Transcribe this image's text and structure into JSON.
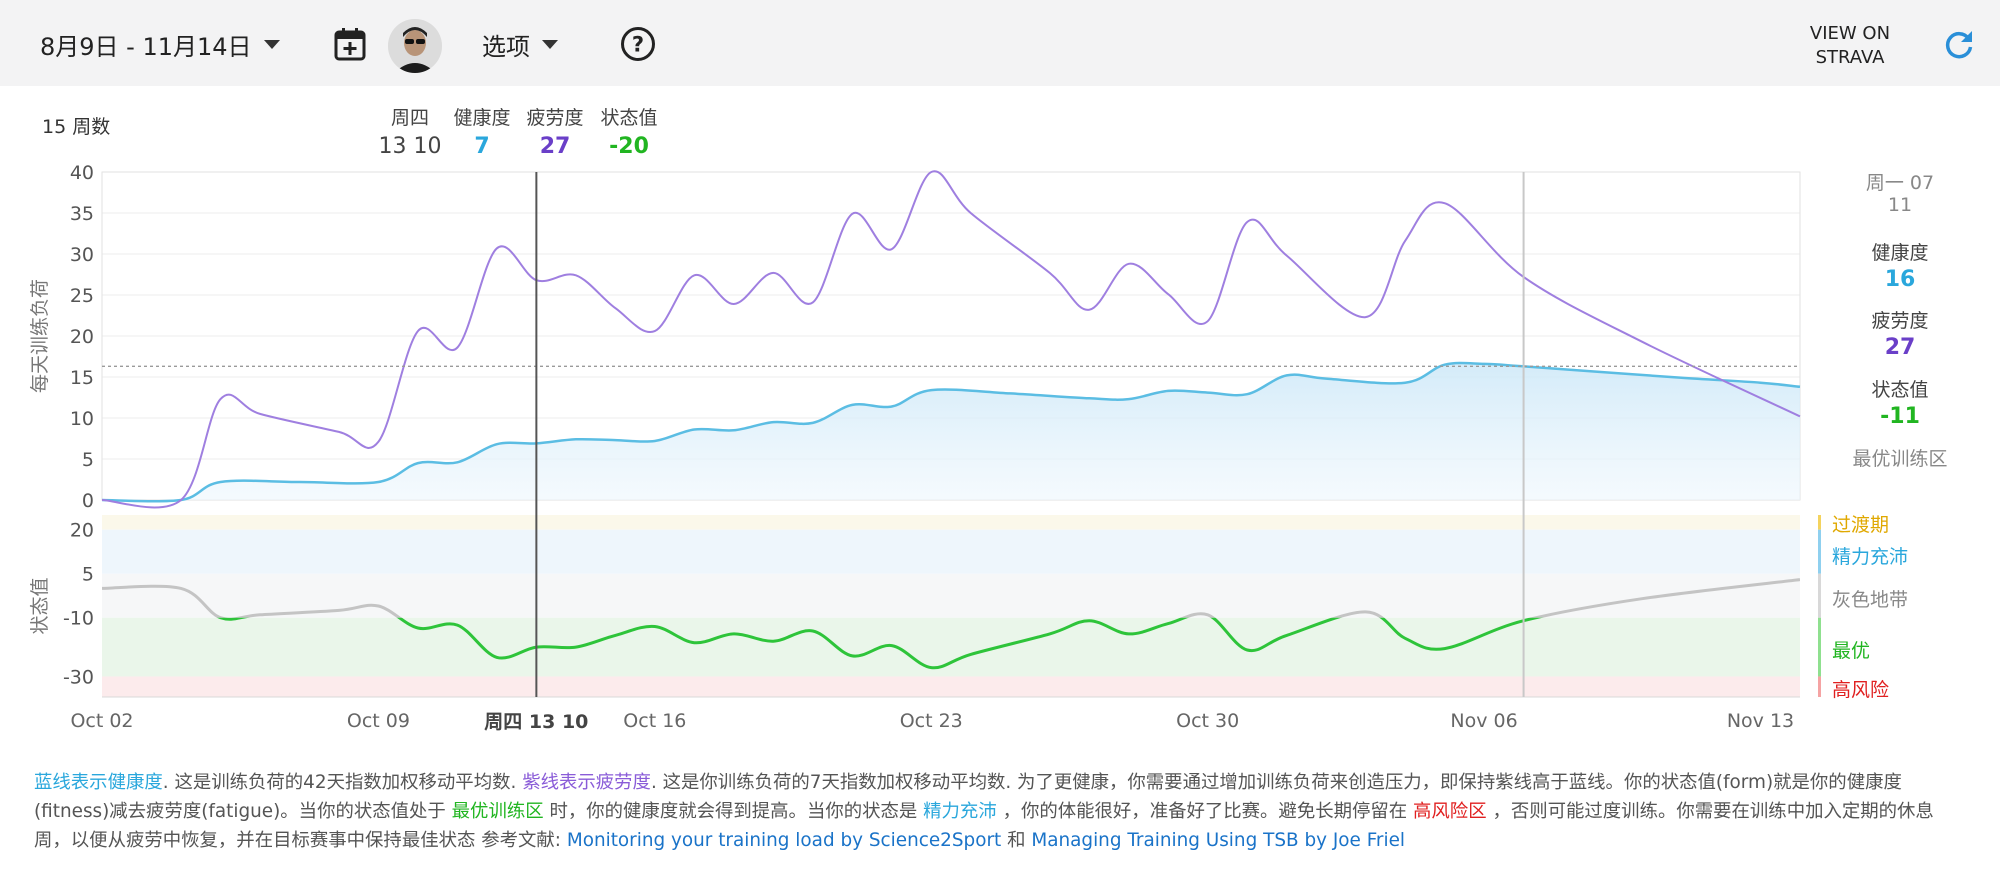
{
  "header": {
    "date_range": "8月9日 - 11月14日",
    "options_label": "选项",
    "view_on_line1": "VIEW ON",
    "view_on_line2": "STRAVA"
  },
  "summary": {
    "weeks": "15 周数"
  },
  "hover": {
    "day_label": "周四",
    "date": "13 10",
    "fitness_label": "健康度",
    "fitness": "7",
    "fatigue_label": "疲劳度",
    "fatigue": "27",
    "form_label": "状态值",
    "form": "-20",
    "axis_label": "周四 13 10"
  },
  "right_panel": {
    "date_line1": "周一 07",
    "date_line2": "11",
    "fitness_label": "健康度",
    "fitness": "16",
    "fatigue_label": "疲劳度",
    "fatigue": "27",
    "form_label": "状态值",
    "form": "-11",
    "current_zone": "最优训练区"
  },
  "zones": [
    {
      "label": "过渡期",
      "color": "#e0a800"
    },
    {
      "label": "精力充沛",
      "color": "#2aa7dc"
    },
    {
      "label": "灰色地带",
      "color": "#888888"
    },
    {
      "label": "最优",
      "color": "#21b521"
    },
    {
      "label": "高风险",
      "color": "#e02020"
    }
  ],
  "colors": {
    "fitness": "#5bbde3",
    "fatigue": "#9f7fe0",
    "form": "#2ec43a",
    "form_grey": "#c4c4c4"
  },
  "chart_data": [
    {
      "type": "line",
      "ylabel": "每天训练负荷",
      "ylim": [
        0,
        40
      ],
      "yticks": [
        "0",
        "5",
        "10",
        "15",
        "20",
        "25",
        "30",
        "35",
        "40"
      ],
      "x_range": [
        "2023-10-02",
        "2023-11-14"
      ],
      "x_ticks": [
        "Oct 02",
        "Oct 09",
        "Oct 16",
        "Oct 23",
        "Oct 30",
        "Nov 06",
        "Nov 13"
      ],
      "grid": true,
      "reference_line": 16.3,
      "series": [
        {
          "name": "健康度",
          "points": [
            [
              "2023-10-02",
              0
            ],
            [
              "2023-10-04",
              0
            ],
            [
              "2023-10-05",
              2.2
            ],
            [
              "2023-10-07",
              2.2
            ],
            [
              "2023-10-09",
              2.2
            ],
            [
              "2023-10-10",
              4.5
            ],
            [
              "2023-10-11",
              4.6
            ],
            [
              "2023-10-12",
              6.8
            ],
            [
              "2023-10-13",
              6.9
            ],
            [
              "2023-10-14",
              7.4
            ],
            [
              "2023-10-15",
              7.3
            ],
            [
              "2023-10-16",
              7.2
            ],
            [
              "2023-10-17",
              8.6
            ],
            [
              "2023-10-18",
              8.5
            ],
            [
              "2023-10-19",
              9.5
            ],
            [
              "2023-10-20",
              9.4
            ],
            [
              "2023-10-21",
              11.6
            ],
            [
              "2023-10-22",
              11.4
            ],
            [
              "2023-10-23",
              13.4
            ],
            [
              "2023-10-25",
              13
            ],
            [
              "2023-10-27",
              12.4
            ],
            [
              "2023-10-28",
              12.3
            ],
            [
              "2023-10-29",
              13.3
            ],
            [
              "2023-10-30",
              13.1
            ],
            [
              "2023-10-31",
              12.9
            ],
            [
              "2023-11-01",
              15.2
            ],
            [
              "2023-11-02",
              14.8
            ],
            [
              "2023-11-04",
              14.3
            ],
            [
              "2023-11-05",
              16.5
            ],
            [
              "2023-11-06",
              16.6
            ],
            [
              "2023-11-07",
              16.3
            ],
            [
              "2023-11-09",
              15.6
            ],
            [
              "2023-11-11",
              14.9
            ],
            [
              "2023-11-13",
              14.3
            ],
            [
              "2023-11-14",
              13.8
            ]
          ]
        },
        {
          "name": "疲劳度",
          "points": [
            [
              "2023-10-02",
              0
            ],
            [
              "2023-10-04",
              0
            ],
            [
              "2023-10-05",
              12.3
            ],
            [
              "2023-10-06",
              10.5
            ],
            [
              "2023-10-08",
              8.3
            ],
            [
              "2023-10-09",
              7.1
            ],
            [
              "2023-10-10",
              20.6
            ],
            [
              "2023-10-11",
              18.6
            ],
            [
              "2023-10-12",
              30.7
            ],
            [
              "2023-10-13",
              26.8
            ],
            [
              "2023-10-14",
              27.4
            ],
            [
              "2023-10-15",
              23.4
            ],
            [
              "2023-10-16",
              20.6
            ],
            [
              "2023-10-17",
              27.4
            ],
            [
              "2023-10-18",
              23.9
            ],
            [
              "2023-10-19",
              27.7
            ],
            [
              "2023-10-20",
              24.1
            ],
            [
              "2023-10-21",
              34.9
            ],
            [
              "2023-10-22",
              30.6
            ],
            [
              "2023-10-23",
              40
            ],
            [
              "2023-10-24",
              35
            ],
            [
              "2023-10-26",
              27.7
            ],
            [
              "2023-10-27",
              23.2
            ],
            [
              "2023-10-28",
              28.8
            ],
            [
              "2023-10-29",
              25.1
            ],
            [
              "2023-10-30",
              21.8
            ],
            [
              "2023-10-31",
              33.9
            ],
            [
              "2023-11-01",
              29.8
            ],
            [
              "2023-11-03",
              22.3
            ],
            [
              "2023-11-04",
              31.6
            ],
            [
              "2023-11-05",
              36.2
            ],
            [
              "2023-11-07",
              27.2
            ],
            [
              "2023-11-10",
              19.3
            ],
            [
              "2023-11-14",
              10.2
            ]
          ]
        }
      ]
    },
    {
      "type": "line",
      "ylabel": "状态值",
      "ylim": [
        -37,
        25
      ],
      "yticks": [
        "20",
        "5",
        "-10",
        "-30"
      ],
      "zone_bands": [
        {
          "label": "过渡期",
          "from": 20,
          "to": 25
        },
        {
          "label": "精力充沛",
          "from": 5,
          "to": 20
        },
        {
          "label": "灰色地带",
          "from": -10,
          "to": 5
        },
        {
          "label": "最优",
          "from": -30,
          "to": -10
        },
        {
          "label": "高风险",
          "from": -37,
          "to": -30
        }
      ],
      "series": [
        {
          "name": "状态值",
          "points": [
            [
              "2023-10-02",
              0
            ],
            [
              "2023-10-04",
              0
            ],
            [
              "2023-10-05",
              -10
            ],
            [
              "2023-10-06",
              -9
            ],
            [
              "2023-10-08",
              -7.5
            ],
            [
              "2023-10-09",
              -6
            ],
            [
              "2023-10-10",
              -13.5
            ],
            [
              "2023-10-11",
              -12.5
            ],
            [
              "2023-10-12",
              -23.5
            ],
            [
              "2023-10-13",
              -20
            ],
            [
              "2023-10-14",
              -20
            ],
            [
              "2023-10-15",
              -16
            ],
            [
              "2023-10-16",
              -13
            ],
            [
              "2023-10-17",
              -18.5
            ],
            [
              "2023-10-18",
              -15.5
            ],
            [
              "2023-10-19",
              -18
            ],
            [
              "2023-10-20",
              -14.5
            ],
            [
              "2023-10-21",
              -23
            ],
            [
              "2023-10-22",
              -19.5
            ],
            [
              "2023-10-23",
              -27
            ],
            [
              "2023-10-24",
              -22.5
            ],
            [
              "2023-10-26",
              -15.5
            ],
            [
              "2023-10-27",
              -11
            ],
            [
              "2023-10-28",
              -15.5
            ],
            [
              "2023-10-29",
              -12
            ],
            [
              "2023-10-30",
              -9
            ],
            [
              "2023-10-31",
              -21
            ],
            [
              "2023-11-01",
              -16
            ],
            [
              "2023-11-03",
              -8
            ],
            [
              "2023-11-04",
              -17
            ],
            [
              "2023-11-05",
              -20.5
            ],
            [
              "2023-11-07",
              -11
            ],
            [
              "2023-11-10",
              -3.5
            ],
            [
              "2023-11-14",
              3
            ]
          ]
        }
      ]
    }
  ],
  "footer": {
    "fitness_desc": "蓝线表示健康度",
    "text1": ". 这是训练负荷的42天指数加权移动平均数. ",
    "fatigue_desc": "紫线表示疲劳度",
    "text2": ". 这是你训练负荷的7天指数加权移动平均数. 为了更健康，你需要通过增加训练负荷来创造压力，即保持紫线高于蓝线。你的状态值(form)就是你的健康度(fitness)减去疲劳度(fatigue)。当你的状态值处于 ",
    "optimal": "最优训练区",
    "text3": " 时，你的健康度就会得到提高。当你的状态是 ",
    "fresh": "精力充沛",
    "text4": " ，你的体能很好，准备好了比赛。避免长期停留在 ",
    "risk": "高风险区",
    "text5": " ，否则可能过度训练。你需要在训练中加入定期的休息周，以便从疲劳中恢复，并在目标赛事中保持最佳状态 参考文献: ",
    "link1": "Monitoring your training load by Science2Sport",
    "and": " 和 ",
    "link2": "Managing Training Using TSB by Joe Friel"
  }
}
